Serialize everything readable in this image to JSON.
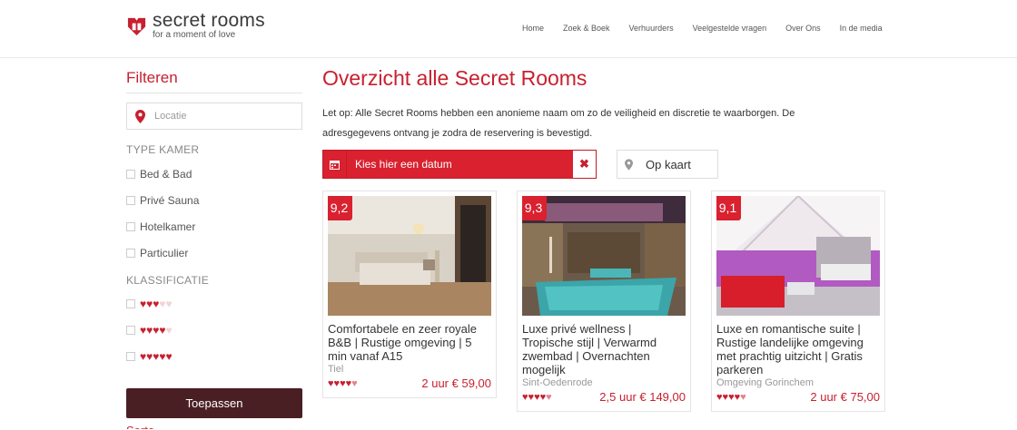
{
  "brand": {
    "name": "secret rooms",
    "tagline": "for a moment of love"
  },
  "nav": [
    "Home",
    "Zoek & Boek",
    "Verhuurders",
    "Veelgestelde vragen",
    "Over Ons",
    "In de media"
  ],
  "sidebar": {
    "title": "Filteren",
    "location_placeholder": "Locatie",
    "room_type_label": "TYPE KAMER",
    "room_types": [
      "Bed & Bad",
      "Privé Sauna",
      "Hotelkamer",
      "Particulier"
    ],
    "classification_label": "KLASSIFICATIE",
    "classification_levels": [
      3,
      4,
      5
    ],
    "apply_label": "Toepassen",
    "more_label": "Sorteren"
  },
  "main": {
    "title": "Overzicht alle Secret Rooms",
    "notice": "Let op: Alle Secret Rooms hebben een anonieme naam om zo de veiligheid en discretie te waarborgen. De adresgegevens ontvang je zodra de reservering is bevestigd.",
    "date_label": "Kies hier een datum",
    "map_label": "Op kaart"
  },
  "rooms": [
    {
      "score": "9,2",
      "title": "Comfortabele en zeer royale B&B | Rustige omgeving | 5 min vanaf A15",
      "location": "Tiel",
      "price": "2 uur € 59,00",
      "rating": 4.5
    },
    {
      "score": "9,3",
      "title": "Luxe privé wellness | Tropische stijl | Verwarmd zwembad | Overnachten mogelijk",
      "location": "Sint-Oedenrode",
      "price": "2,5 uur € 149,00",
      "rating": 4.5
    },
    {
      "score": "9,1",
      "title": "Luxe en romantische suite | Rustige landelijke omgeving met prachtig uitzicht | Gratis parkeren",
      "location": "Omgeving Gorinchem",
      "price": "2 uur € 75,00",
      "rating": 4.5
    }
  ],
  "colors": {
    "accent": "#c8202f",
    "apply_button": "#4a1f24"
  }
}
